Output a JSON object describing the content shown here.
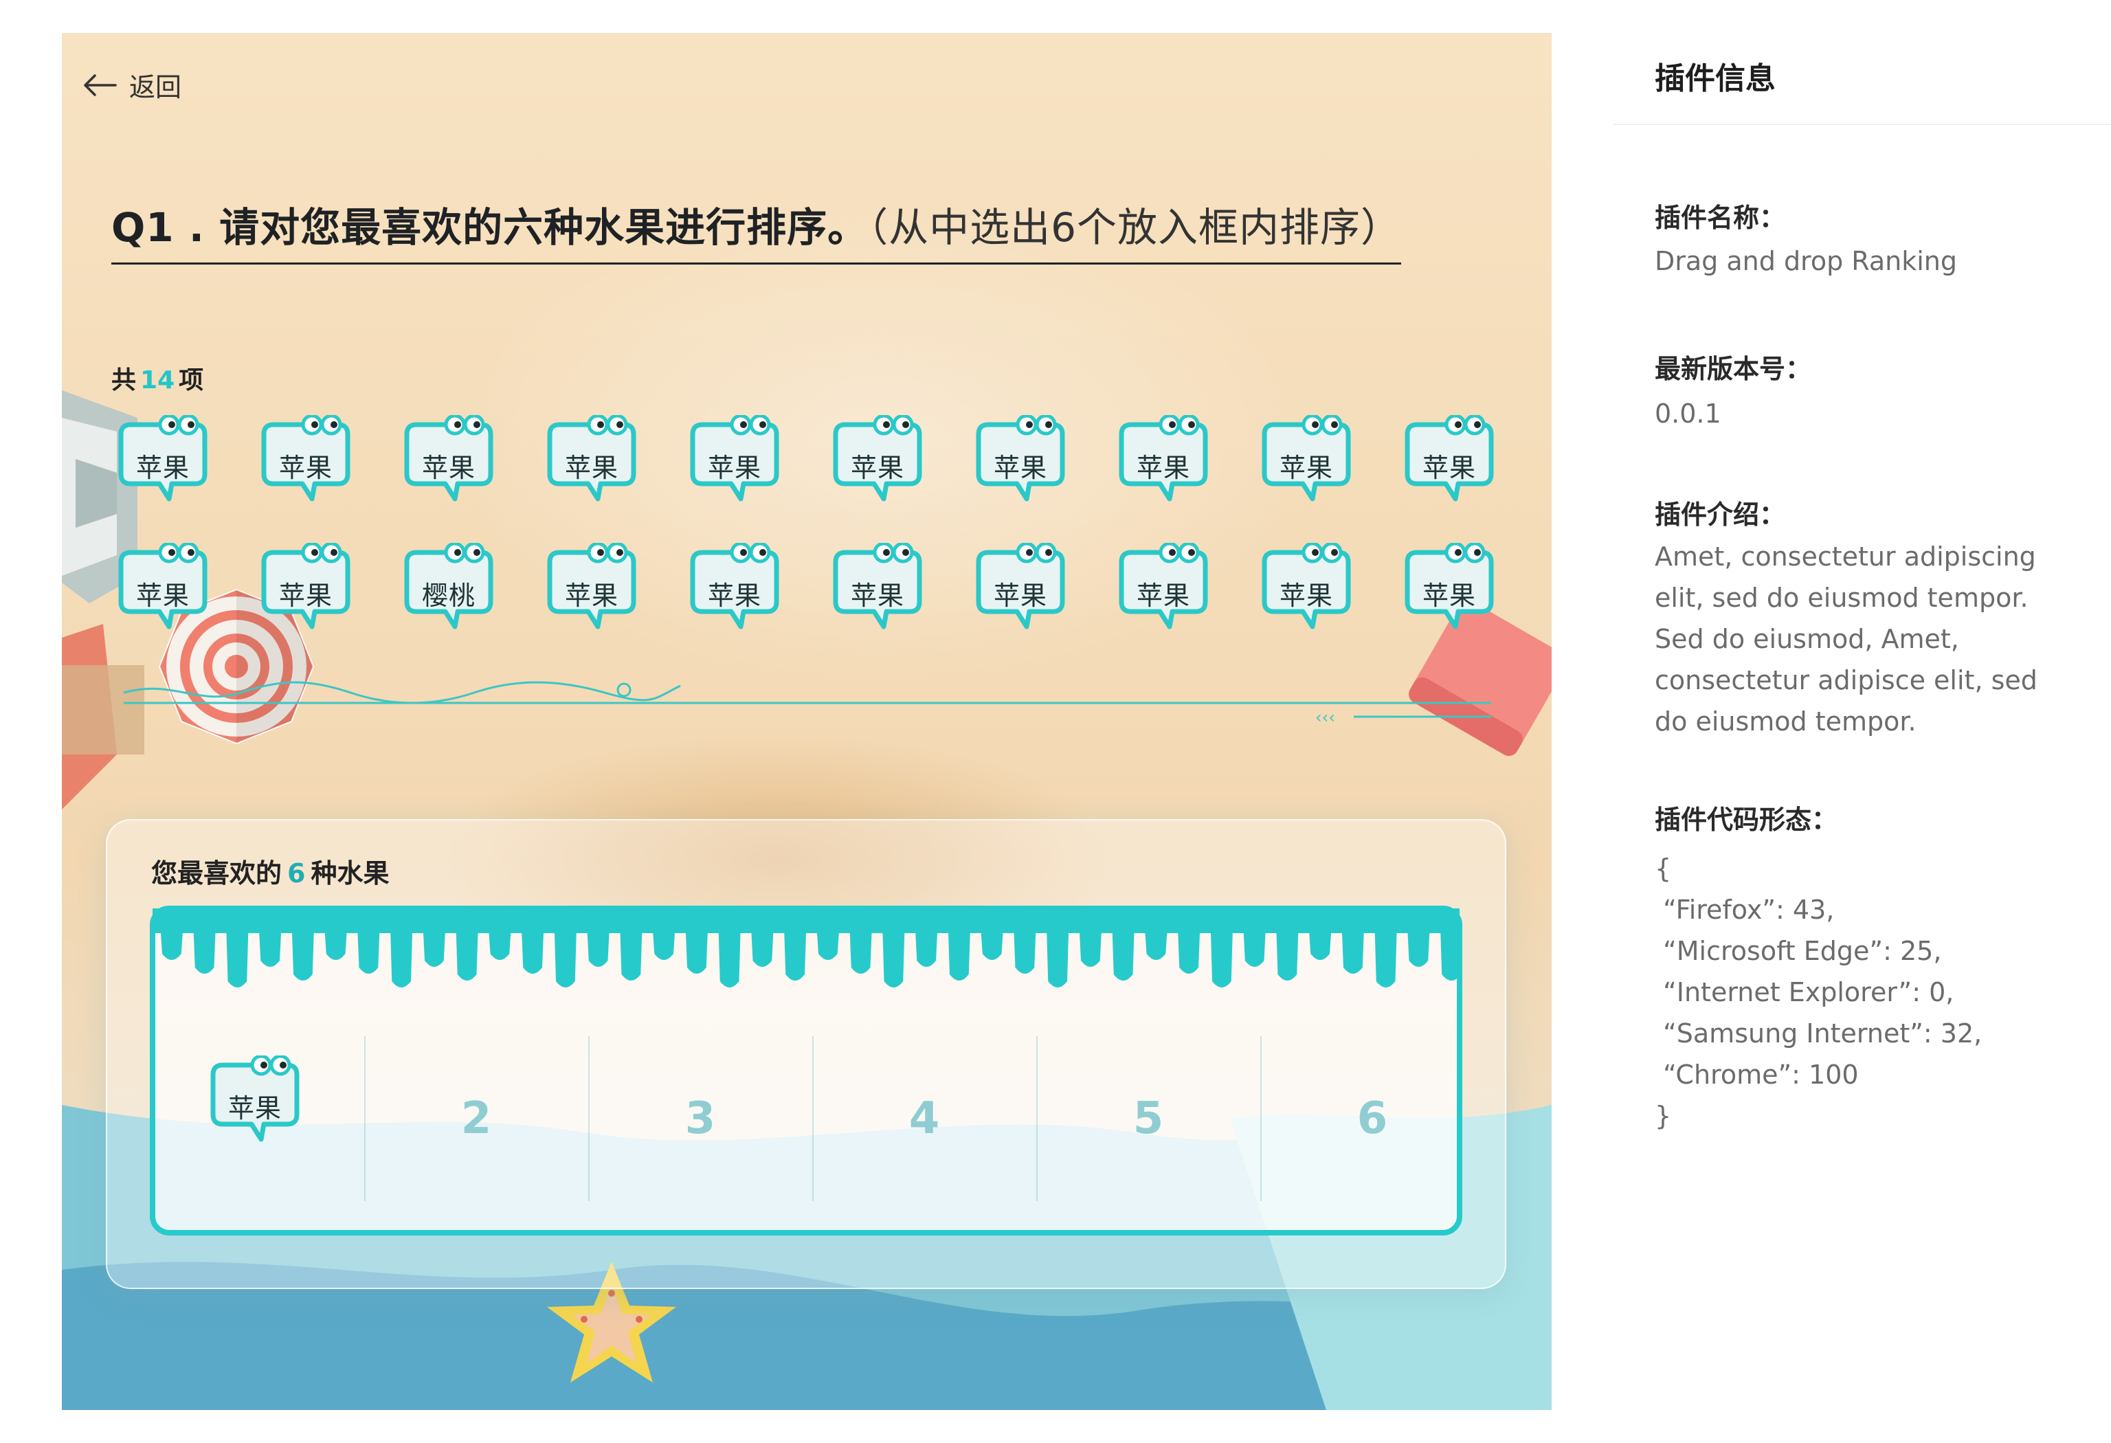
{
  "stage": {
    "back_label": "返回",
    "question_main": "Q1 . 请对您最喜欢的六种水果进行排序。",
    "question_sub": "（从中选出6个放入框内排序）",
    "count_prefix": "共",
    "count_value": "14",
    "count_suffix": "项",
    "items": [
      "苹果",
      "苹果",
      "苹果",
      "苹果",
      "苹果",
      "苹果",
      "苹果",
      "苹果",
      "苹果",
      "苹果",
      "苹果",
      "苹果",
      "樱桃",
      "苹果",
      "苹果",
      "苹果",
      "苹果",
      "苹果",
      "苹果",
      "苹果"
    ],
    "rank_title_prefix": "您最喜欢的",
    "rank_title_value": "6",
    "rank_title_suffix": "种水果",
    "rank_first_item": "苹果",
    "rank_slots": [
      "2",
      "3",
      "4",
      "5",
      "6"
    ],
    "colors": {
      "accent": "#21c6c9",
      "bubble_border": "#2cc8c8",
      "question_text": "#1f2225"
    }
  },
  "sidebar": {
    "title": "插件信息",
    "name_label": "插件名称：",
    "name_value": "Drag and drop Ranking",
    "version_label": "最新版本号：",
    "version_value": "0.0.1",
    "intro_label": "插件介绍：",
    "intro_value": "Amet, consectetur adipiscing elit, sed do eiusmod tempor. Sed do eiusmod, Amet, consectetur adipisce elit, sed do eiusmod tempor.",
    "code_label": "插件代码形态：",
    "code_value": "{\n “Firefox”: 43,\n “Microsoft Edge”: 25,\n “Internet Explorer”: 0,\n “Samsung Internet”: 32,\n “Chrome”: 100\n}"
  },
  "icons": [
    "back-arrow-icon",
    "bubble-eyes-icon"
  ]
}
